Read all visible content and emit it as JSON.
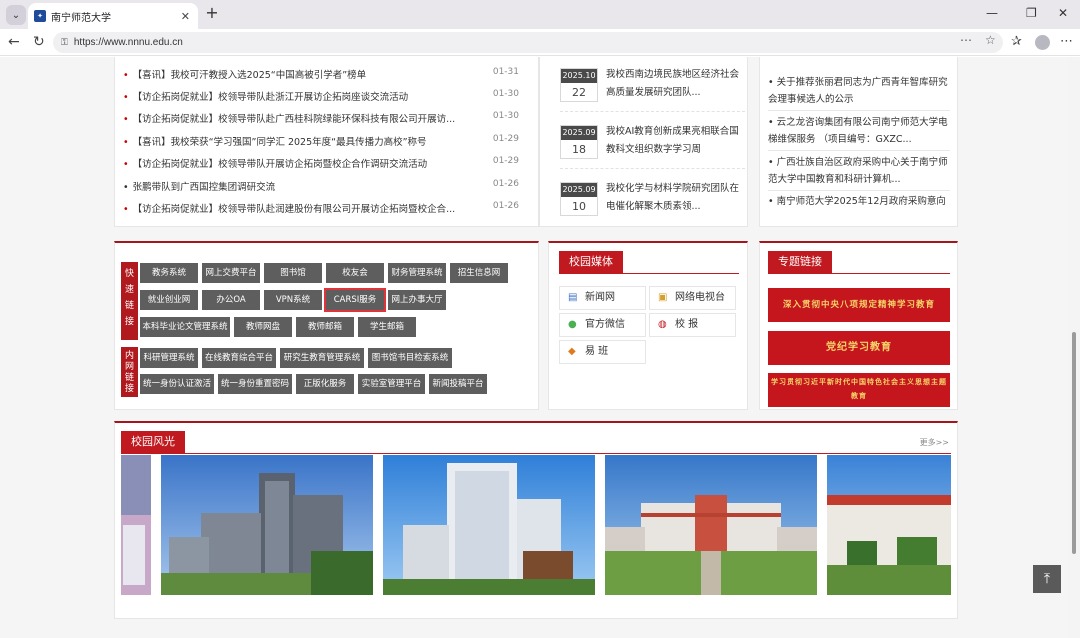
{
  "browser": {
    "tab_title": "南宁师范大学",
    "url": "https://www.nnnu.edu.cn"
  },
  "news_list": [
    {
      "title": "【喜讯】我校可汗教授入选2025“中国高被引学者”榜单",
      "date": "01-31"
    },
    {
      "title": "【访企拓岗促就业】校领导带队赴浙江开展访企拓岗座谈交流活动",
      "date": "01-30"
    },
    {
      "title": "【访企拓岗促就业】校领导带队赴广西桂科院绿能环保科技有限公司开展访...",
      "date": "01-30"
    },
    {
      "title": "【喜讯】我校荣获“学习强国”同学汇 2025年度“最具传播力高校”称号",
      "date": "01-29"
    },
    {
      "title": "【访企拓岗促就业】校领导带队开展访企拓岗暨校企合作调研交流活动",
      "date": "01-29"
    },
    {
      "title": "张鹏带队到广西国控集团调研交流",
      "date": "01-26"
    },
    {
      "title": "【访企拓岗促就业】校领导带队赴润建股份有限公司开展访企拓岗暨校企合...",
      "date": "01-26"
    }
  ],
  "middle_news": [
    {
      "ym": "2025.10",
      "day": "22",
      "title": "我校西南边境民族地区经济社会高质量发展研究团队..."
    },
    {
      "ym": "2025.09",
      "day": "18",
      "title": "我校AI教育创新成果亮相联合国教科文组织数字学习周"
    },
    {
      "ym": "2025.09",
      "day": "10",
      "title": "我校化学与材料学院研究团队在电催化解聚木质素领..."
    }
  ],
  "right_news": [
    "关于推荐张丽君同志为广西青年智库研究会理事候选人的公示",
    "云之龙咨询集团有限公司南宁师范大学电梯维保服务 （项目编号：GXZC...",
    "广西壮族自治区政府采购中心关于南宁师范大学中国教育和科研计算机...",
    "南宁师范大学2025年12月政府采购意向"
  ],
  "quick_links": {
    "label_chars": [
      "快",
      "速",
      "链",
      "接"
    ],
    "row1": [
      "教务系统",
      "网上交费平台",
      "图书馆",
      "校友会",
      "财务管理系统",
      "招生信息网"
    ],
    "row2": [
      "就业创业网",
      "办公OA",
      "VPN系统",
      "CARSI服务",
      "网上办事大厅"
    ],
    "row3": [
      "本科毕业论文管理系统",
      "教师网盘",
      "教师邮箱",
      "学生邮箱"
    ]
  },
  "internal_links": {
    "label_chars": [
      "内",
      "网",
      "链",
      "接"
    ],
    "row1": [
      "科研管理系统",
      "在线教育综合平台",
      "研究生教育管理系统",
      "图书馆书目检索系统"
    ],
    "row2": [
      "统一身份认证激活",
      "统一身份重置密码",
      "正版化服务",
      "实验室管理平台",
      "新闻投稿平台"
    ]
  },
  "campus_media": {
    "title": "校园媒体",
    "items": [
      "新闻网",
      "网络电视台",
      "官方微信",
      "校 报",
      "易 班"
    ]
  },
  "special_links": {
    "title": "专题链接",
    "banners": [
      "深入贯彻中央八项规定精神学习教育",
      "党纪学习教育",
      "学习贯彻习近平新时代中国特色社会主义思想主题教育"
    ]
  },
  "campus_scenery": {
    "title": "校园风光",
    "more": "更多>>"
  },
  "colors": {
    "accent_red": "#c0191f",
    "button_gray": "#5e5e5e"
  }
}
